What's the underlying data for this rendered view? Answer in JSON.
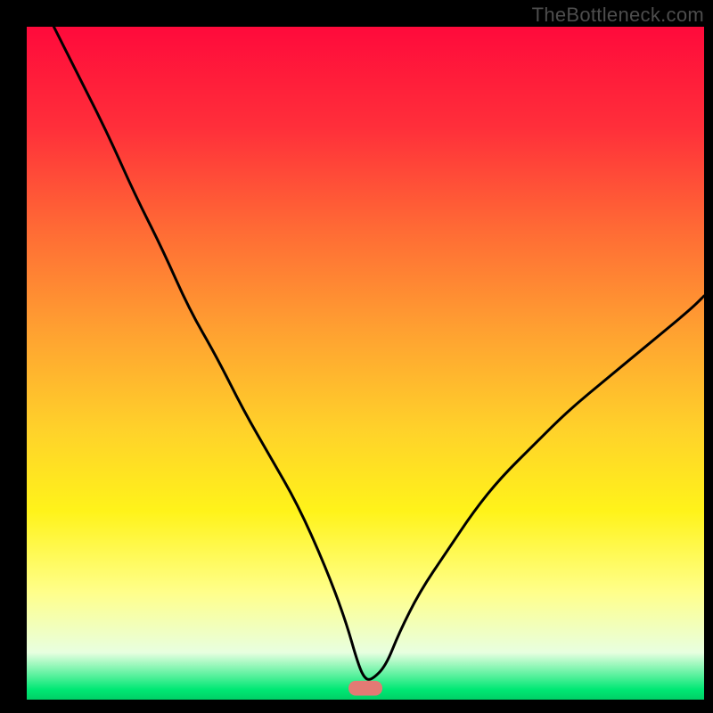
{
  "watermark": "TheBottleneck.com",
  "chart_data": {
    "type": "line",
    "title": "",
    "xlabel": "",
    "ylabel": "",
    "xlim": [
      0,
      100
    ],
    "ylim": [
      0,
      100
    ],
    "legend": false,
    "grid": false,
    "background": {
      "type": "vertical-gradient",
      "stops": [
        {
          "pos": 0.0,
          "color": "#ff0a3b"
        },
        {
          "pos": 0.15,
          "color": "#ff2f3a"
        },
        {
          "pos": 0.3,
          "color": "#ff6a35"
        },
        {
          "pos": 0.45,
          "color": "#ffa031"
        },
        {
          "pos": 0.6,
          "color": "#ffd22a"
        },
        {
          "pos": 0.72,
          "color": "#fff31a"
        },
        {
          "pos": 0.84,
          "color": "#ffff8a"
        },
        {
          "pos": 0.93,
          "color": "#e8ffe0"
        },
        {
          "pos": 0.985,
          "color": "#00e874"
        },
        {
          "pos": 1.0,
          "color": "#00cf66"
        }
      ]
    },
    "series": [
      {
        "name": "bottleneck-curve",
        "x": [
          4,
          8,
          12,
          16,
          20,
          24,
          28,
          32,
          36,
          40,
          44,
          47,
          49,
          50,
          51,
          53,
          55,
          58,
          62,
          66,
          70,
          75,
          80,
          86,
          92,
          98,
          100
        ],
        "values": [
          100,
          92,
          84,
          75,
          67,
          58,
          51,
          43,
          36,
          29,
          20,
          12,
          5,
          3,
          3,
          5,
          10,
          16,
          22,
          28,
          33,
          38,
          43,
          48,
          53,
          58,
          60
        ]
      }
    ],
    "marker": {
      "name": "optimal-range",
      "x": 50,
      "y": 1.7,
      "width": 5,
      "height": 2.2,
      "color": "#e37a74"
    }
  }
}
